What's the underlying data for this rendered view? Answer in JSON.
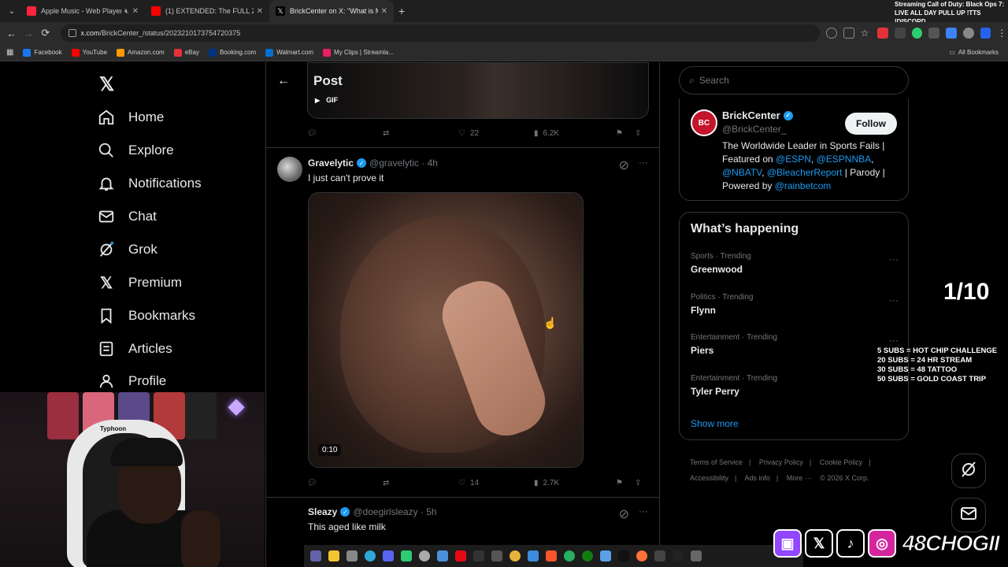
{
  "browser": {
    "tabs": [
      {
        "title": "Apple Music - Web Player",
        "color": "#fa243c"
      },
      {
        "title": "(1) EXTENDED: The FULL 2026 I",
        "color": "#ff0000"
      },
      {
        "title": "BrickCenter on X: \"What is Mic",
        "color": "#000000"
      }
    ],
    "new_tab": "+",
    "url_host": "x.com",
    "url_path": "/BrickCenter_/status/2023210173754720375",
    "bookmarks": [
      {
        "label": "Facebook",
        "color": "#1877f2"
      },
      {
        "label": "YouTube",
        "color": "#ff0000"
      },
      {
        "label": "Amazon.com",
        "color": "#ff9900"
      },
      {
        "label": "eBay",
        "color": "#e53238"
      },
      {
        "label": "Booking.com",
        "color": "#003580"
      },
      {
        "label": "Walmart.com",
        "color": "#0071ce"
      },
      {
        "label": "My Clips | Streamla...",
        "color": "#e91e63"
      }
    ],
    "all_bookmarks": "All Bookmarks"
  },
  "stream_message": "Streaming Call of Duty: Black Ops 7: LIVE ALL DAY PULL UP !TTS !DISCORD",
  "nav": {
    "items": [
      {
        "label": "Home",
        "icon": "home-icon"
      },
      {
        "label": "Explore",
        "icon": "search-icon"
      },
      {
        "label": "Notifications",
        "icon": "bell-icon"
      },
      {
        "label": "Chat",
        "icon": "mail-icon"
      },
      {
        "label": "Grok",
        "icon": "grok-icon"
      },
      {
        "label": "Premium",
        "icon": "x-icon"
      },
      {
        "label": "Bookmarks",
        "icon": "bookmark-icon"
      },
      {
        "label": "Articles",
        "icon": "articles-icon"
      },
      {
        "label": "Profile",
        "icon": "profile-icon"
      }
    ]
  },
  "post": {
    "header_title": "Post",
    "gif_label": "GIF",
    "top_actions": {
      "likes": "22",
      "views": "6.2K"
    },
    "reply1": {
      "name": "Gravelytic",
      "handle": "@gravelytic",
      "time": "4h",
      "text": "I just can't prove it",
      "video_time": "0:10",
      "likes": "14",
      "views": "2.7K"
    },
    "reply2": {
      "name": "Sleazy",
      "handle": "@doegirlsleazy",
      "time": "5h",
      "text": "This aged like milk"
    }
  },
  "search": {
    "placeholder": "Search"
  },
  "profile_card": {
    "avatar_text": "BC",
    "name": "BrickCenter",
    "handle": "@BrickCenter_",
    "follow_label": "Follow",
    "bio_line1": "The Worldwide Leader in Sports Fails |",
    "bio_featured": "Featured on ",
    "bio_espn": "@ESPN",
    "bio_sep1": ", ",
    "bio_espnnba": "@ESPNNBA",
    "bio_sep2": ",",
    "bio_nbatv": "@NBATV",
    "bio_sep3": ", ",
    "bio_br": "@BleacherReport",
    "bio_parody": " | Parody |",
    "bio_powered": "Powered by ",
    "bio_rainbet": "@rainbetcom"
  },
  "happening": {
    "title": "What’s happening",
    "trends": [
      {
        "category": "Sports · Trending",
        "name": "Greenwood"
      },
      {
        "category": "Politics · Trending",
        "name": "Flynn"
      },
      {
        "category": "Entertainment · Trending",
        "name": "Piers"
      },
      {
        "category": "Entertainment · Trending",
        "name": "Tyler Perry"
      }
    ],
    "show_more": "Show more"
  },
  "footer": {
    "terms": "Terms of Service",
    "privacy": "Privacy Policy",
    "cookie": "Cookie Policy",
    "accessibility": "Accessibility",
    "ads": "Ads info",
    "more": "More ···",
    "copyright": "© 2026 X Corp."
  },
  "overlay": {
    "counter": "1/10",
    "goals": [
      "5 SUBS = HOT CHIP CHALLENGE",
      "20 SUBS = 24 HR STREAM",
      "30 SUBS = 48 TATTOO",
      "50 SUBS = GOLD COAST TRIP"
    ],
    "chair_brand": "Typhoon",
    "channel": "48CHOGII"
  }
}
